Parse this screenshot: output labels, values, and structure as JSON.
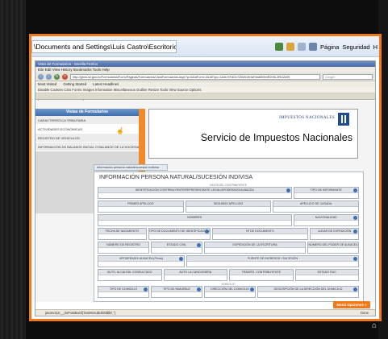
{
  "ie": {
    "path": "\\Documents and Settings\\Luis Castro\\Escritorio\\pre...",
    "tools": {
      "page_label": "Página",
      "security_label": "Seguridad",
      "overflow": "H"
    }
  },
  "firefox": {
    "title": "Vista de Formularios - Mozilla Firefox",
    "menu": "Eile  Edit  View  History  Bookmarks  Tools  Help",
    "url": "http://gforo.sii.gov.ec/Formularios/Form/Paginas/Formularios/ListaFormularios.aspx?p=6&idForm=2&IdTipo=1&id=SFdOcTZkWGhHaFdwM09mR2hSL3RUZz09",
    "search_placeholder": "Google",
    "bookmarks": [
      "Most Visited",
      "Getting Started",
      "Latest Headlines"
    ],
    "addons": "Disable  Cookies  CSS  Forms  Images  Information  Miscellaneous  Outline  Resize  Tools  View Source  Options",
    "tab": "Vista de Formularios",
    "status_url": "javascript:__doPostBack('lvwMenu$ctl00$lbt','')",
    "status_right": "Done"
  },
  "lista": {
    "title": "Vistas de Formularios",
    "items": [
      "CARACTERISTICA TRIBUTARIA",
      "ACTIVIDADES ECONOMICAS",
      "REGISTRO DE VEHICULOS",
      "INFORMACION DE BALANCE INICIAL O BALANCE DE LA SOCIEDAD DE HECHO"
    ]
  },
  "header": {
    "logo_text": "IMPUESTOS NACIONALES",
    "title": "Servicio de Impuestos Nacionales"
  },
  "form": {
    "tab": "Información persona natural/sucesión indivisa",
    "title": "INFORMACIÓN PERSONA NATURAL/SUCESIÓN INDIVISA",
    "rows": [
      [
        "IDENTIFICACIÓN CONTRIBUYENTE/REPRESENTANTE LEGAL/APODERADO/ALBACEA",
        "TIPO DE INFORMANTE"
      ],
      [
        "PRIMER APELLIDO",
        "SEGUNDO APELLIDO",
        "APELLIDO DE CASADA"
      ],
      [
        "NOMBRES",
        "NACIONALIDAD"
      ],
      [
        "FECHA DE NACIMIENTO",
        "TIPO DE DOCUMENTO DE IDENTIFICACIÓN",
        "Nº DE DOCUMENTO",
        "LUGAR DE EXPEDICIÓN"
      ],
      [
        "NÚMERO DE REGISTRO",
        "ESTADO CIVIL",
        "EXPEDICIÓN DE LA ESCRITURA",
        "NÚMERO DEL PODER DE ALBACEA"
      ],
      [
        "APODERADO/ ALBACEA (Firma)",
        "FUENTE DE INGRESOS / SUCESIÓN"
      ],
      [
        "AUTO, ALCALDÍA, CONSULTADO",
        "AUTO LA CANCIONERA",
        "TRÁMITE. CONTRIBUYENTE",
        "ESTADO RUC"
      ],
      [
        "TIPO DE DOMICILIO",
        "TIPO DE INMUEBLE",
        "DIRECCIÓN DEL DOMICILIO",
        "DESCRIPCIÓN DE LA DIRECCIÓN DEL DOMICILIO"
      ]
    ],
    "caption_top": "DATOS DEL CONTRIBUYENTE",
    "caption_mid": "DOMICILIO"
  },
  "menu_opciones": "Menú Opciones »",
  "colors": {
    "accent": "#f07a1a",
    "header_blue": "#3e6fae"
  }
}
